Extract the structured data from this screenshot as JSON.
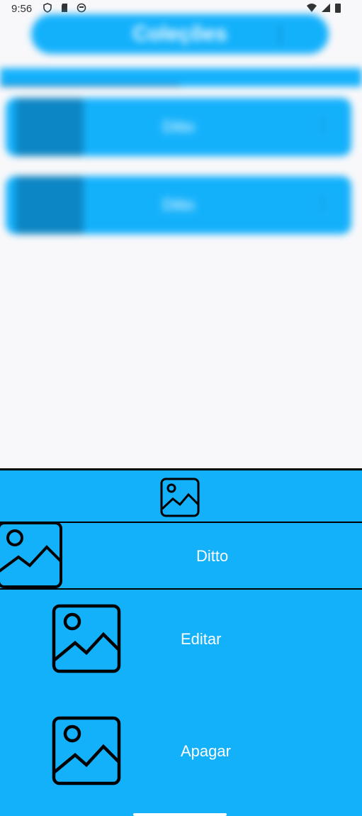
{
  "status_bar": {
    "time": "9:56",
    "left_icons": [
      "shield-icon",
      "sd-card-icon",
      "face-icon"
    ],
    "right_icons": [
      "wifi-icon",
      "signal-icon",
      "battery-icon"
    ]
  },
  "background": {
    "title": "Coleções",
    "tabs": [
      "",
      ""
    ],
    "cards": [
      {
        "label": "Ditto"
      },
      {
        "label": "Ditto"
      }
    ]
  },
  "sheet": {
    "selected_item": {
      "label": "Ditto",
      "icon": "image-icon"
    },
    "actions": [
      {
        "label": "Editar",
        "icon": "image-icon"
      },
      {
        "label": "Apagar",
        "icon": "image-icon"
      }
    ]
  },
  "colors": {
    "accent": "#14b1fb",
    "background": "#f8f8fa",
    "text_on_accent": "#ffffff"
  }
}
